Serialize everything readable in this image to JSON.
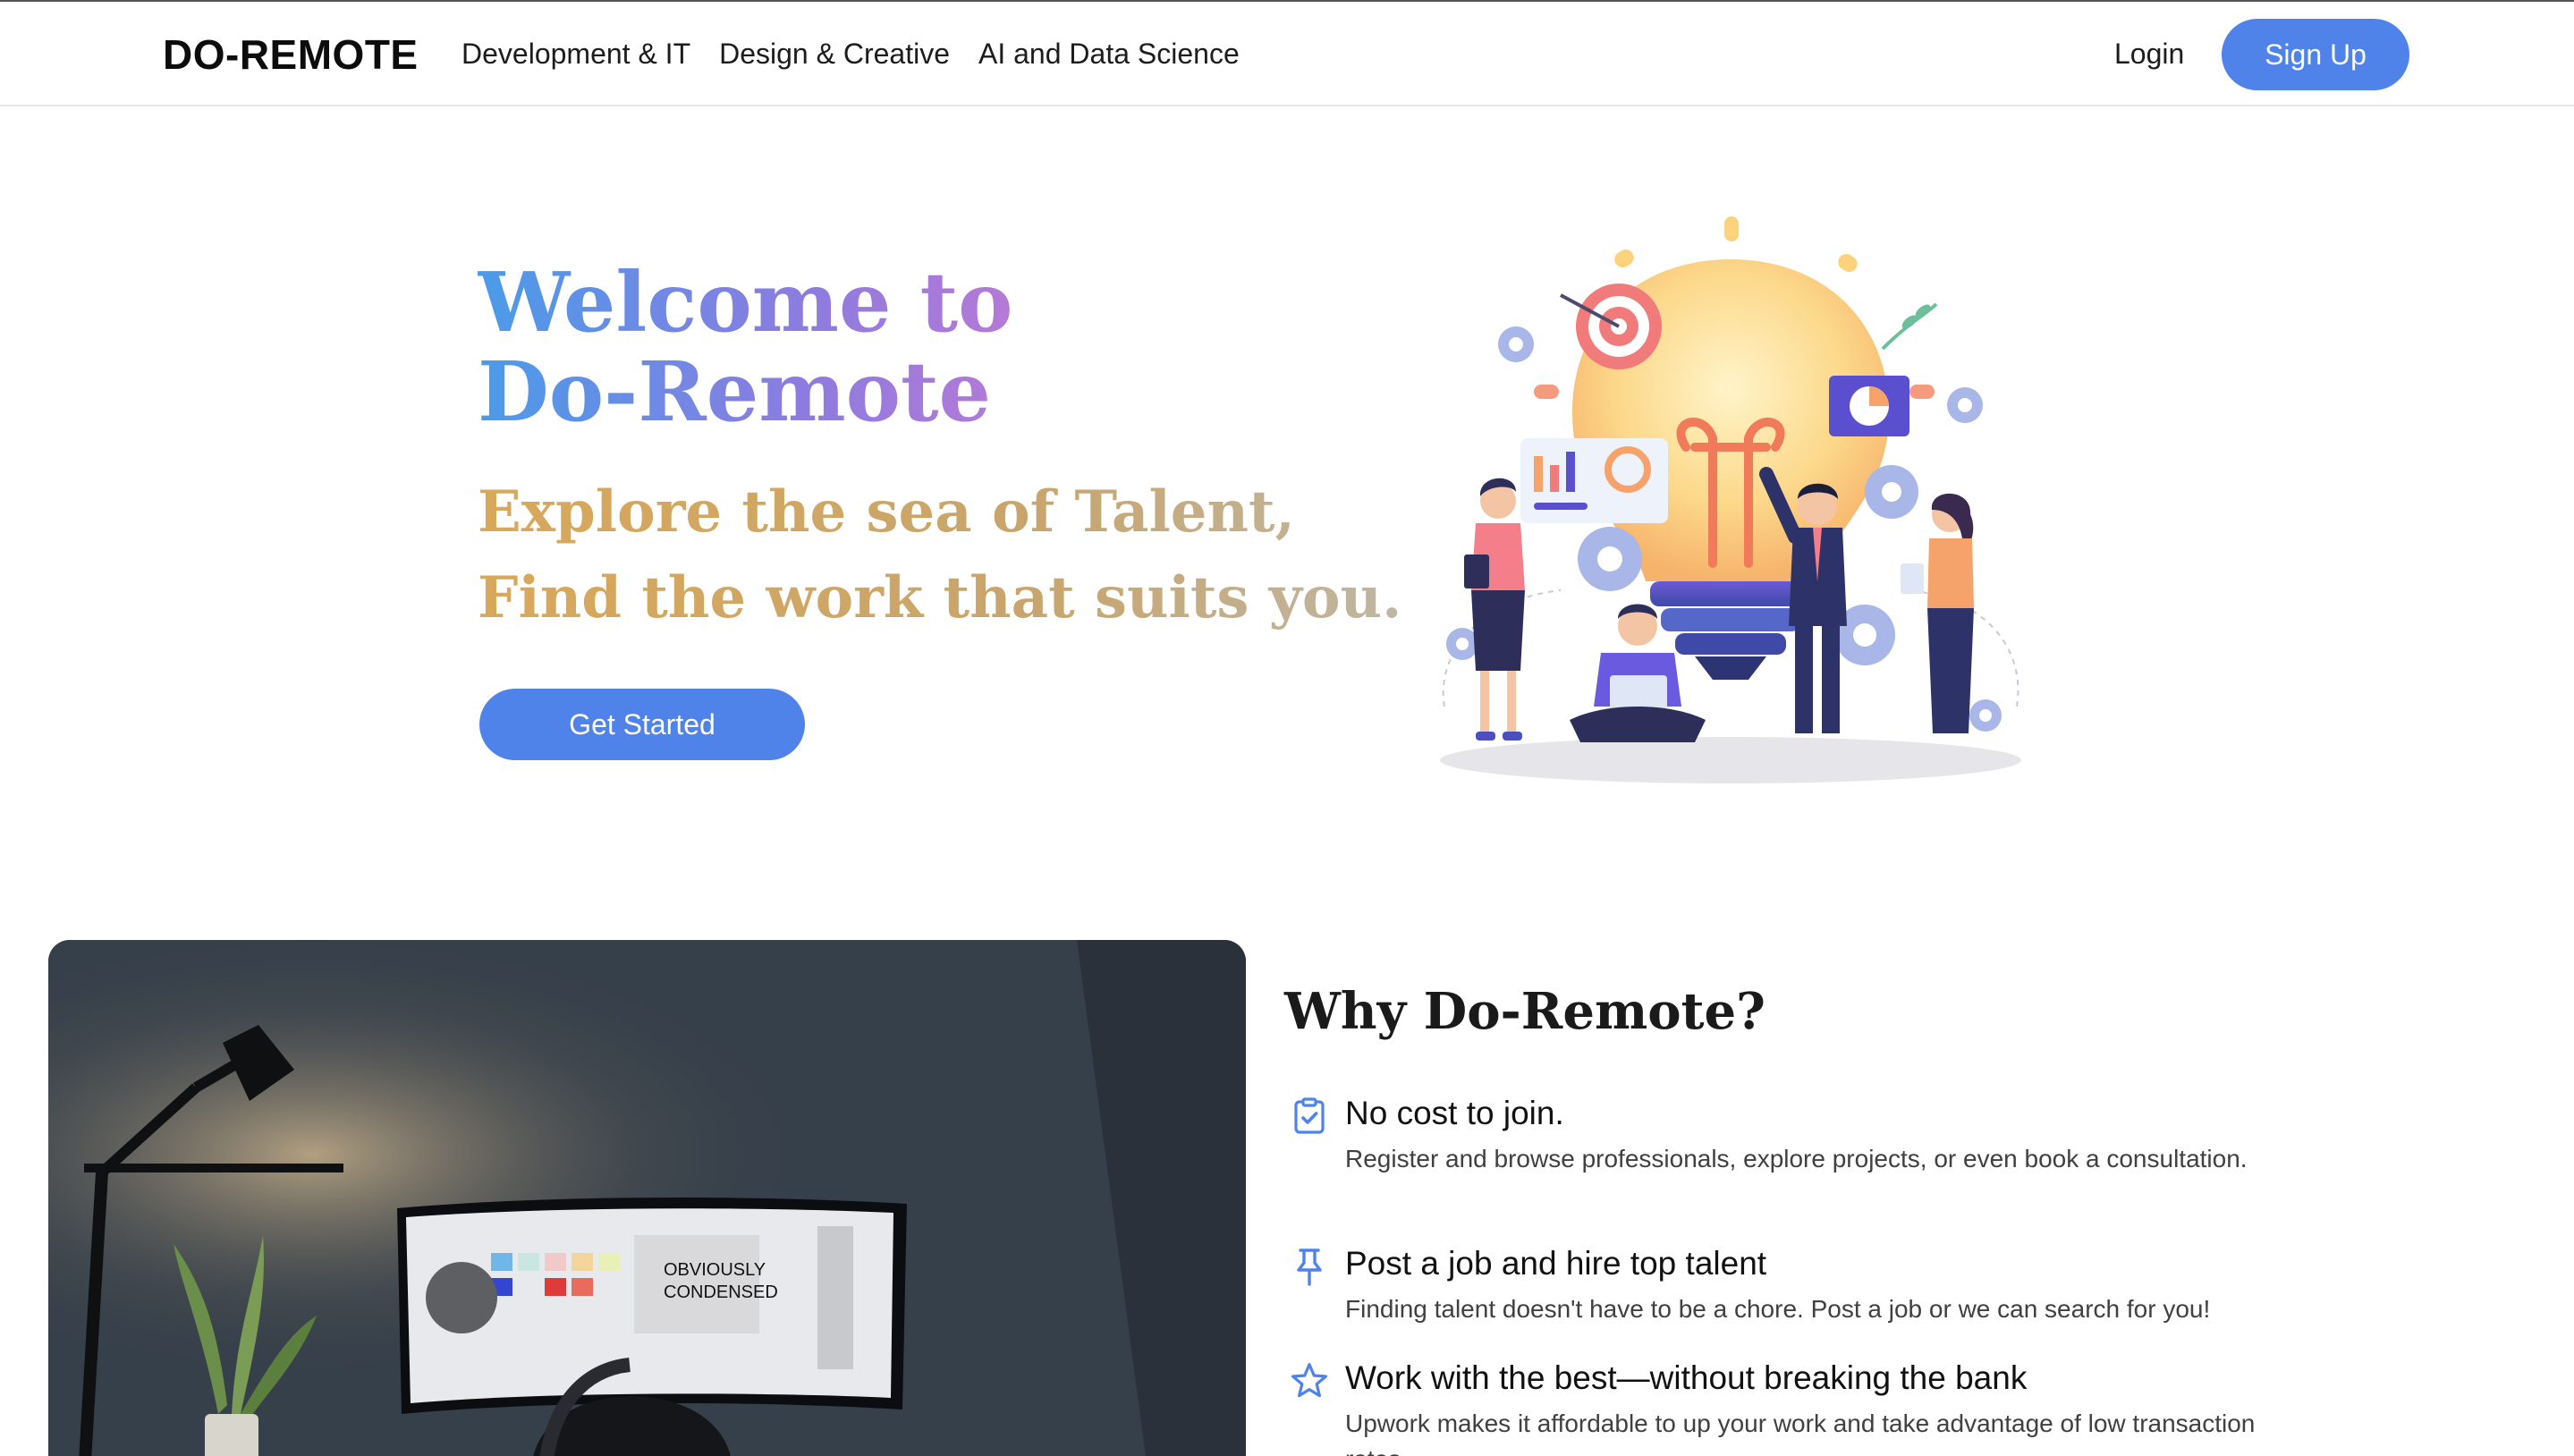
{
  "navbar": {
    "brand": "DO-REMOTE",
    "links": [
      "Development & IT",
      "Design & Creative",
      "AI and Data Science"
    ],
    "login_label": "Login",
    "signup_label": "Sign Up"
  },
  "hero": {
    "title_line1": "Welcome to",
    "title_line2": "Do-Remote",
    "subtitle_line1": "Explore the sea of Talent,",
    "subtitle_line2": "Find the work that suits you.",
    "cta_label": "Get Started"
  },
  "why": {
    "title": "Why Do-Remote?",
    "features": [
      {
        "icon": "clipboard-check-icon",
        "title": "No cost to join.",
        "description": "Register and browse professionals, explore projects, or even book a consultation."
      },
      {
        "icon": "pin-icon",
        "title": "Post a job and hire top talent",
        "description": "Finding talent doesn't have to be a chore. Post a job or we can search for you!"
      },
      {
        "icon": "star-icon",
        "title": "Work with the best—without breaking the bank",
        "description": "Upwork makes it affordable to up your work and take advantage of low transaction rates."
      }
    ]
  },
  "photo_overlay": {
    "screen_text_line1": "OBVIOUSLY",
    "screen_text_line2": "CONDENSED"
  },
  "colors": {
    "accent": "#4f83ea",
    "title_gradient_start": "#4a9be9",
    "title_gradient_end": "#b57ad6",
    "subtitle_gradient_start": "#d9a85a",
    "subtitle_gradient_end": "#bfb6a3"
  }
}
